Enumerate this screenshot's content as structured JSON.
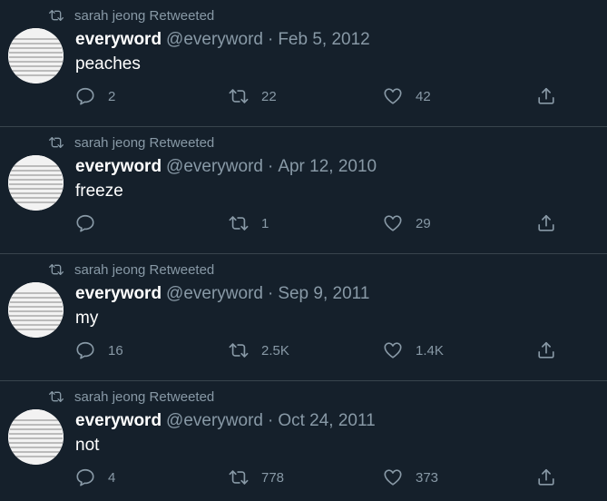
{
  "tweets": [
    {
      "retweeted_by": "sarah jeong Retweeted",
      "display_name": "everyword",
      "handle": "@everyword",
      "separator": "·",
      "date": "Feb 5, 2012",
      "text": "peaches",
      "replies": "2",
      "retweets": "22",
      "likes": "42"
    },
    {
      "retweeted_by": "sarah jeong Retweeted",
      "display_name": "everyword",
      "handle": "@everyword",
      "separator": "·",
      "date": "Apr 12, 2010",
      "text": "freeze",
      "replies": "",
      "retweets": "1",
      "likes": "29"
    },
    {
      "retweeted_by": "sarah jeong Retweeted",
      "display_name": "everyword",
      "handle": "@everyword",
      "separator": "·",
      "date": "Sep 9, 2011",
      "text": "my",
      "replies": "16",
      "retweets": "2.5K",
      "likes": "1.4K"
    },
    {
      "retweeted_by": "sarah jeong Retweeted",
      "display_name": "everyword",
      "handle": "@everyword",
      "separator": "·",
      "date": "Oct 24, 2011",
      "text": "not",
      "replies": "4",
      "retweets": "778",
      "likes": "373"
    }
  ],
  "icons": {
    "retweeted_indicator": "retweet-icon",
    "reply": "reply-icon",
    "retweet": "retweet-icon",
    "like": "heart-icon",
    "share": "share-icon"
  },
  "colors": {
    "background": "#15202b",
    "muted_text": "#8899a6",
    "divider": "#38444d",
    "primary_text": "#ffffff"
  }
}
